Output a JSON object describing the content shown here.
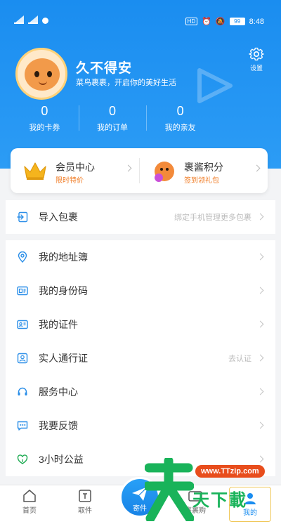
{
  "status_bar": {
    "hd_label": "HD",
    "battery": "99",
    "time": "8:48"
  },
  "profile": {
    "username": "久不得安",
    "slogan": "菜鸟裹裹，开启你的美好生活",
    "settings_label": "设置"
  },
  "stats": [
    {
      "value": "0",
      "label": "我的卡券"
    },
    {
      "value": "0",
      "label": "我的订单"
    },
    {
      "value": "0",
      "label": "我的亲友"
    }
  ],
  "member": {
    "left": {
      "title": "会员中心",
      "subtitle": "限时特价"
    },
    "right": {
      "title": "裹酱积分",
      "subtitle": "签到领礼包"
    }
  },
  "import_row": {
    "label": "导入包裹",
    "hint": "绑定手机管理更多包裹"
  },
  "menu": [
    {
      "label": "我的地址簿",
      "hint": "",
      "icon": "location-icon"
    },
    {
      "label": "我的身份码",
      "hint": "",
      "icon": "id-code-icon"
    },
    {
      "label": "我的证件",
      "hint": "",
      "icon": "id-card-icon"
    },
    {
      "label": "实人通行证",
      "hint": "去认证",
      "icon": "person-badge-icon"
    },
    {
      "label": "服务中心",
      "hint": "",
      "icon": "headset-icon"
    },
    {
      "label": "我要反馈",
      "hint": "",
      "icon": "feedback-icon"
    },
    {
      "label": "3小时公益",
      "hint": "",
      "icon": "charity-icon"
    }
  ],
  "tabs": {
    "home": "首页",
    "pickup": "取件",
    "send": "寄件",
    "shop": "裹裹购",
    "mine": "我的"
  },
  "watermark": {
    "url": "www.TTzip.com",
    "text": "天下載"
  },
  "colors": {
    "primary": "#1a8df0",
    "accent_orange": "#f07a22",
    "watermark_green": "#19b35a"
  }
}
